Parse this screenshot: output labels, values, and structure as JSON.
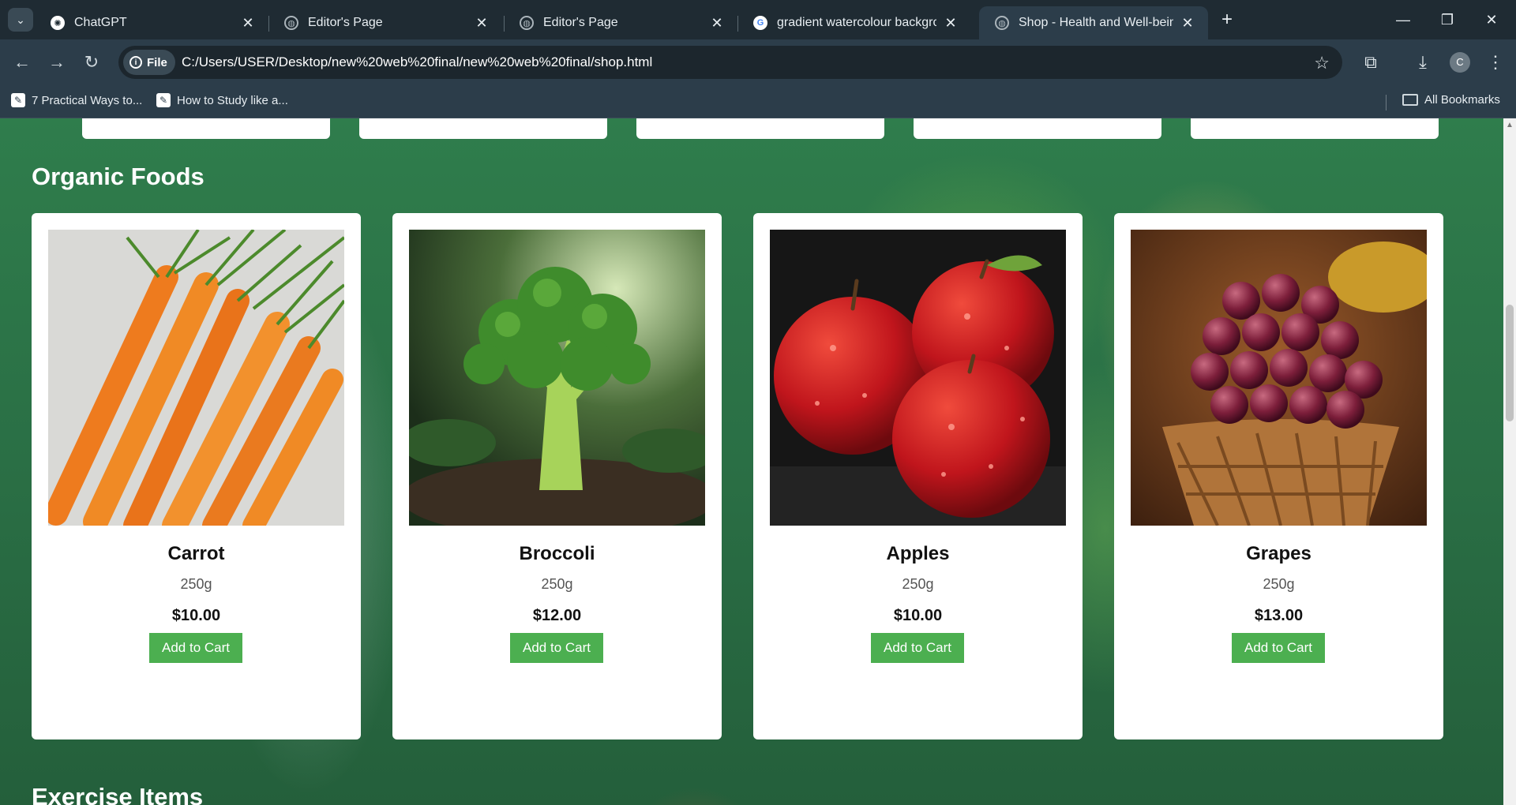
{
  "browser": {
    "tabs": [
      {
        "title": "ChatGPT",
        "favicon": "chatgpt-icon"
      },
      {
        "title": "Editor's Page",
        "favicon": "globe-icon"
      },
      {
        "title": "Editor's Page",
        "favicon": "globe-icon"
      },
      {
        "title": "gradient watercolour backgrour",
        "favicon": "google-icon"
      },
      {
        "title": "Shop - Health and Well-being",
        "favicon": "globe-icon",
        "active": true
      }
    ],
    "url_chip": "File",
    "url": "C:/Users/USER/Desktop/new%20web%20final/new%20web%20final/shop.html",
    "profile_initial": "C",
    "bookmarks": [
      {
        "label": "7 Practical Ways to..."
      },
      {
        "label": "How to Study like a..."
      }
    ],
    "all_bookmarks": "All Bookmarks"
  },
  "page": {
    "section_title": "Organic Foods",
    "next_section_title": "Exercise Items",
    "products": [
      {
        "name": "Carrot",
        "weight": "250g",
        "price": "$10.00",
        "button": "Add to Cart",
        "image": "carrot-image"
      },
      {
        "name": "Broccoli",
        "weight": "250g",
        "price": "$12.00",
        "button": "Add to Cart",
        "image": "broccoli-image"
      },
      {
        "name": "Apples",
        "weight": "250g",
        "price": "$10.00",
        "button": "Add to Cart",
        "image": "apples-image"
      },
      {
        "name": "Grapes",
        "weight": "250g",
        "price": "$13.00",
        "button": "Add to Cart",
        "image": "grapes-image"
      }
    ]
  },
  "colors": {
    "button": "#4caf50",
    "background": "#2f7d4c",
    "chrome": "#2c3d4a"
  }
}
